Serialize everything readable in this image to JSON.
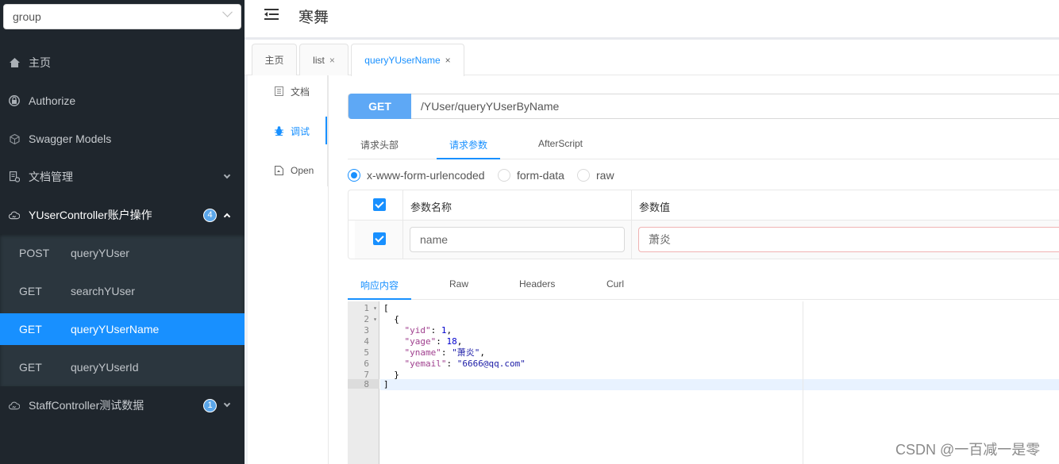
{
  "sidebar": {
    "group_select": {
      "value": "group"
    },
    "items": [
      {
        "label": "主页",
        "icon": "home-icon"
      },
      {
        "label": "Authorize",
        "icon": "lock-icon"
      },
      {
        "label": "Swagger Models",
        "icon": "cube-icon"
      },
      {
        "label": "文档管理",
        "icon": "doc-settings-icon"
      },
      {
        "label": "YUserController账户操作",
        "icon": "cloud-icon",
        "badge": "4"
      },
      {
        "label": "StaffController测试数据",
        "icon": "cloud-icon",
        "badge": "1"
      }
    ],
    "sub_items": [
      {
        "method": "POST",
        "name": "queryYUser"
      },
      {
        "method": "GET",
        "name": "searchYUser"
      },
      {
        "method": "GET",
        "name": "queryYUserName",
        "active": true
      },
      {
        "method": "GET",
        "name": "queryYUserId"
      }
    ]
  },
  "header": {
    "title": "寒舞"
  },
  "page_tabs": [
    {
      "label": "主页"
    },
    {
      "label": "list",
      "close": "×"
    },
    {
      "label": "queryYUserName",
      "close": "×",
      "active": true
    }
  ],
  "side_tabs": [
    {
      "label": "文档"
    },
    {
      "label": "调试",
      "active": true
    },
    {
      "label": "Open"
    }
  ],
  "request": {
    "method": "GET",
    "url": "/YUser/queryYUserByName",
    "tabs": [
      {
        "label": "请求头部"
      },
      {
        "label": "请求参数",
        "active": true
      },
      {
        "label": "AfterScript"
      }
    ],
    "content_types": [
      {
        "label": "x-www-form-urlencoded",
        "checked": true
      },
      {
        "label": "form-data"
      },
      {
        "label": "raw"
      }
    ],
    "params_table": {
      "headers": [
        "参数名称",
        "参数值"
      ],
      "rows": [
        {
          "checked": true,
          "name": "name",
          "value": "萧炎"
        }
      ]
    }
  },
  "response": {
    "tabs": [
      {
        "label": "响应内容",
        "active": true
      },
      {
        "label": "Raw"
      },
      {
        "label": "Headers"
      },
      {
        "label": "Curl"
      }
    ],
    "line_numbers": [
      "1",
      "2",
      "3",
      "4",
      "5",
      "6",
      "7",
      "8"
    ],
    "body": {
      "yid_key": "\"yid\"",
      "yid_val": "1",
      "yage_key": "\"yage\"",
      "yage_val": "18",
      "yname_key": "\"yname\"",
      "yname_val": "\"萧炎\"",
      "yemail_key": "\"yemail\"",
      "yemail_val": "\"6666@qq.com\""
    }
  },
  "watermark": "CSDN @一百减一是零",
  "colors": {
    "accent": "#1890ff",
    "sidebar_bg": "#1f262d",
    "submenu_bg": "#2b363e",
    "get_method": "#5ea8f5"
  }
}
